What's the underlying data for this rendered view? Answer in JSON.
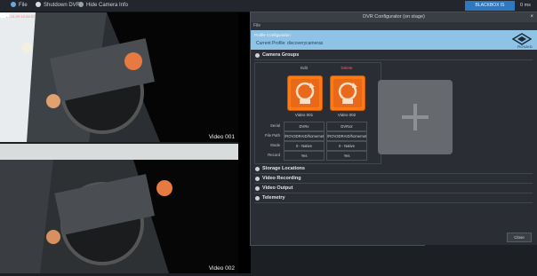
{
  "topbar": {
    "items": [
      {
        "label": "File",
        "icon": "file-icon"
      },
      {
        "label": "Shutdown DVR",
        "icon": "power-icon"
      },
      {
        "label": "Hide Camera Info",
        "icon": "eye-icon"
      }
    ],
    "recording_badge": "BLACKBOX IS RECORDING",
    "recording_time": "0 ms"
  },
  "videos": [
    {
      "label": "Video 001",
      "timestamp": "2021-01-09 10:06:07"
    },
    {
      "label": "Video 002",
      "timestamp": ""
    }
  ],
  "dialog": {
    "title": "DVR Configurator (on stage)",
    "menu": "File",
    "banner_sub": "Profile Configuration",
    "profile_label": "Current Profile: discoverycameras",
    "logo_text": "ROVAID",
    "sections": [
      {
        "label": "Camera Groups"
      },
      {
        "label": "Storage Locations"
      },
      {
        "label": "Video Recording"
      },
      {
        "label": "Video Output"
      },
      {
        "label": "Telemetry"
      }
    ],
    "table": {
      "col_headers": [
        "Edit",
        "Delete"
      ],
      "cameras": [
        {
          "name": "Video 001",
          "tile": "MP4",
          "serial": "DVRx",
          "file_path": "/ROV3DRAID/homemeta",
          "mode": "0 - Native",
          "record": "Yes"
        },
        {
          "name": "Video 002",
          "tile": "MP4",
          "serial": "DVRx2",
          "file_path": "/ROV3DRAID/homemeta",
          "mode": "0 - Native",
          "record": "Yes"
        }
      ],
      "row_labels": [
        "Serial",
        "File Path",
        "Mode",
        "Record"
      ]
    },
    "close_label": "Close"
  },
  "colors": {
    "accent": "#ff7a10",
    "banner": "#8ec3e6",
    "recording": "#2d78c0"
  }
}
